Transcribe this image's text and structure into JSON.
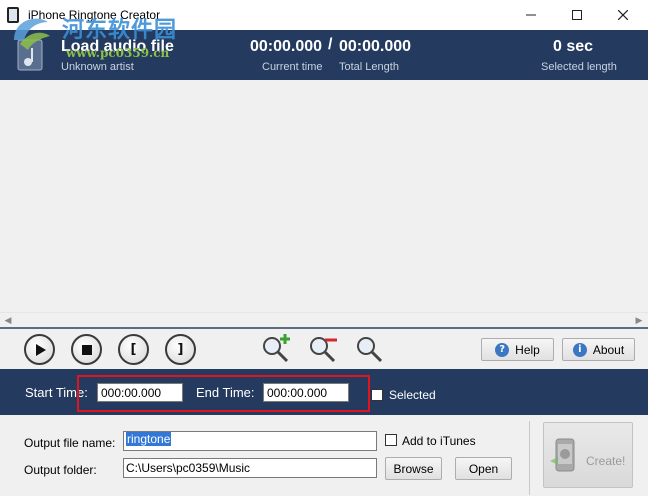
{
  "window": {
    "title": "iPhone Ringtone Creator",
    "watermark_text": "河东软件园",
    "watermark_url": "www.pc0359.cn"
  },
  "header": {
    "title": "Load audio file",
    "artist": "Unknown artist",
    "current_time": "00:00.000",
    "separator": "/",
    "total_length": "00:00.000",
    "current_time_label": "Current time",
    "total_length_label": "Total Length",
    "selected_length": "0 sec",
    "selected_length_label": "Selected length"
  },
  "toolbar": {
    "play_icon": "play-icon",
    "stop_icon": "stop-icon",
    "mark_start_symbol": "[",
    "mark_end_symbol": "]",
    "help_label": "Help",
    "about_label": "About"
  },
  "time_panel": {
    "start_label": "Start Time:",
    "start_value": "000:00.000",
    "end_label": "End Time:",
    "end_value": "000:00.000",
    "selected_label": "Selected",
    "selected_checked": false
  },
  "output": {
    "file_name_label": "Output file name:",
    "file_name_value": "ringtone",
    "folder_label": "Output folder:",
    "folder_value": "C:\\Users\\pc0359\\Music",
    "add_itunes_label": "Add to iTunes",
    "add_itunes_checked": false,
    "browse_label": "Browse",
    "open_label": "Open",
    "create_label": "Create!"
  },
  "colors": {
    "header_bg": "#243a5e",
    "highlight_box": "#e0141e",
    "selection": "#3378d6"
  }
}
